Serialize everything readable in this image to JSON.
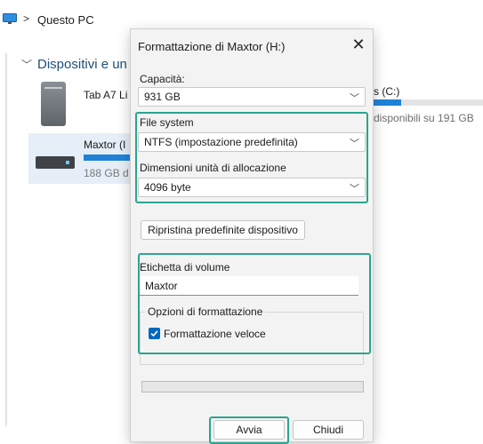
{
  "explorer": {
    "breadcrumb": {
      "sep": ">",
      "location": "Questo PC"
    },
    "group_header": "Dispositivi e un",
    "drives": [
      {
        "name": "Tab A7 Li"
      },
      {
        "name": "Maxtor (I",
        "free": "188 GB d",
        "used_fraction": 1.0
      },
      {
        "name": "s (C:)",
        "free": "disponibili su 191 GB",
        "used_fraction": 0.25
      }
    ]
  },
  "dialog": {
    "title": "Formattazione di Maxtor (H:)",
    "close_glyph": "✕",
    "capacity": {
      "label": "Capacità:",
      "value": "931 GB"
    },
    "file_system": {
      "label": "File system",
      "value": "NTFS (impostazione predefinita)"
    },
    "allocation": {
      "label": "Dimensioni unità di allocazione",
      "value": "4096 byte"
    },
    "restore_button": "Ripristina predefinite dispositivo",
    "volume_label": {
      "label": "Etichetta di volume",
      "value": "Maxtor"
    },
    "format_options": {
      "legend": "Opzioni di formattazione",
      "quick_format": {
        "label": "Formattazione veloce",
        "checked": true
      }
    },
    "progress": {
      "value": 0
    },
    "buttons": {
      "start": "Avvia",
      "close": "Chiudi"
    }
  },
  "colors": {
    "highlight": "#2aa58f",
    "accent": "#0067c0",
    "drive_bar": "#1f82d8"
  }
}
